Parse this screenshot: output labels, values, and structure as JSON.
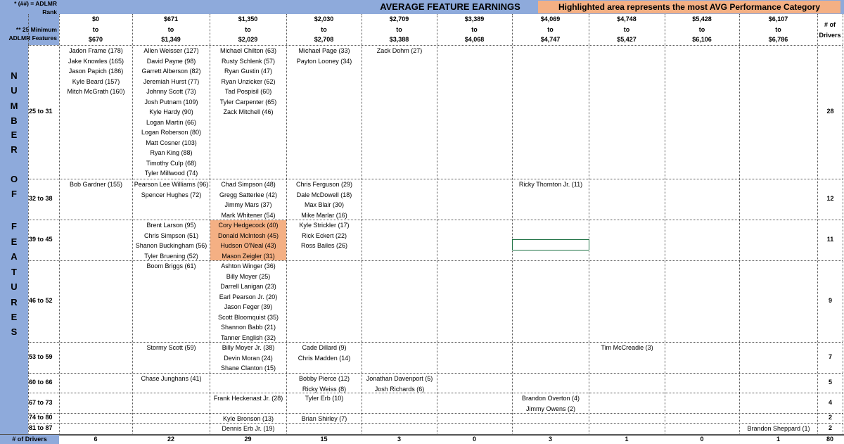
{
  "corner": {
    "line1": "* (##) = ADLMR",
    "line2": "Rank",
    "line3": "** 25  Minimum",
    "line4": "ADLMR Features"
  },
  "title": "AVERAGE FEATURE EARNINGS",
  "highlight_note": "Highlighted area represents the most AVG Performance Category",
  "ranges": [
    {
      "lo": "$0",
      "to": "to",
      "hi": "$670"
    },
    {
      "lo": "$671",
      "to": "to",
      "hi": "$1,349"
    },
    {
      "lo": "$1,350",
      "to": "to",
      "hi": "$2,029"
    },
    {
      "lo": "$2,030",
      "to": "to",
      "hi": "$2,708"
    },
    {
      "lo": "$2,709",
      "to": "to",
      "hi": "$3,388"
    },
    {
      "lo": "$3,389",
      "to": "to",
      "hi": "$4,068"
    },
    {
      "lo": "$4,069",
      "to": "to",
      "hi": "$4,747"
    },
    {
      "lo": "$4,748",
      "to": "to",
      "hi": "$5,427"
    },
    {
      "lo": "$5,428",
      "to": "to",
      "hi": "$6,106"
    },
    {
      "lo": "$6,107",
      "to": "to",
      "hi": "$6,786"
    }
  ],
  "count_header": {
    "line1": "# of",
    "line2": "Drivers"
  },
  "vertical_label": [
    "N",
    "U",
    "M",
    "B",
    "E",
    "R",
    "",
    "O",
    "F",
    "",
    "F",
    "E",
    "A",
    "T",
    "U",
    "R",
    "E",
    "S"
  ],
  "rows": [
    {
      "label": "25 to 31",
      "count": "28",
      "cells": [
        [
          "Jadon Frame (178)",
          "Jake Knowles (165)",
          "Jason Papich (186)",
          "Kyle Beard (157)",
          "Mitch McGrath (160)"
        ],
        [
          "Allen Weisser (127)",
          "David Payne (98)",
          "Garrett Alberson (82)",
          "Jeremiah Hurst (77)",
          "Johnny Scott (73)",
          "Josh Putnam (109)",
          "Kyle Hardy (90)",
          "Logan Martin (66)",
          "Logan Roberson (80)",
          "Matt Cosner (103)",
          "Ryan King (88)",
          "Timothy Culp (68)",
          "Tyler Millwood (74)"
        ],
        [
          "Michael Chilton (63)",
          "Rusty Schlenk (57)",
          "Ryan Gustin (47)",
          "Ryan Unzicker (62)",
          "Tad Pospisil (60)",
          "Tyler Carpenter (65)",
          "Zack Mitchell (46)"
        ],
        [
          "Michael Page (33)",
          "Payton Looney (34)"
        ],
        [
          "Zack Dohm (27)"
        ],
        [],
        [],
        [],
        [],
        []
      ]
    },
    {
      "label": "32 to 38",
      "count": "12",
      "cells": [
        [
          "Bob Gardner (155)"
        ],
        [
          "Pearson Lee Williams (96)",
          "Spencer Hughes (72)"
        ],
        [
          "Chad Simpson (48)",
          "Gregg Satterlee (42)",
          "Jimmy Mars (37)",
          "Mark Whitener (54)"
        ],
        [
          "Chris Ferguson (29)",
          "Dale McDowell (18)",
          "Max Blair (30)",
          "Mike Marlar (16)"
        ],
        [],
        [],
        [
          "Ricky Thornton Jr. (11)"
        ],
        [],
        [],
        []
      ]
    },
    {
      "label": "39 to 45",
      "count": "11",
      "cells": [
        [],
        [
          "Brent Larson (95)",
          "Chris Simpson (51)",
          "Shanon Buckingham (56)",
          "Tyler Bruening (52)"
        ],
        [
          "Cory Hedgecock (40)",
          "Donald McIntosh (45)",
          "Hudson O'Neal (43)",
          "Mason Zeigler (31)"
        ],
        [
          "Kyle Strickler (17)",
          "Rick Eckert (22)",
          "Ross Bailes (26)"
        ],
        [],
        [],
        [],
        [],
        [],
        []
      ]
    },
    {
      "label": "46 to 52",
      "count": "9",
      "cells": [
        [],
        [
          "Boom Briggs (61)"
        ],
        [
          "Ashton Winger (36)",
          "Billy Moyer (25)",
          "Darrell Lanigan (23)",
          "Earl Pearson Jr. (20)",
          "Jason Feger (39)",
          "Scott Bloomquist (35)",
          "Shannon Babb (21)",
          "Tanner English (32)"
        ],
        [],
        [],
        [],
        [],
        [],
        [],
        []
      ]
    },
    {
      "label": "53 to 59",
      "count": "7",
      "cells": [
        [],
        [
          "Stormy Scott (59)"
        ],
        [
          "Billy Moyer Jr. (38)",
          "Devin Moran (24)",
          "Shane Clanton (15)"
        ],
        [
          "Cade Dillard (9)",
          "Chris Madden (14)"
        ],
        [],
        [],
        [],
        [
          "Tim McCreadie (3)"
        ],
        [],
        []
      ]
    },
    {
      "label": "60 to 66",
      "count": "5",
      "cells": [
        [],
        [
          "Chase Junghans (41)"
        ],
        [],
        [
          "Bobby Pierce (12)",
          "Ricky Weiss (8)"
        ],
        [
          "Jonathan Davenport (5)",
          "Josh Richards (6)"
        ],
        [],
        [],
        [],
        [],
        []
      ]
    },
    {
      "label": "67 to 73",
      "count": "4",
      "cells": [
        [],
        [],
        [
          "Frank Heckenast Jr. (28)"
        ],
        [
          "Tyler Erb (10)"
        ],
        [],
        [],
        [
          "Brandon Overton (4)",
          "Jimmy Owens (2)"
        ],
        [],
        [],
        []
      ]
    },
    {
      "label": "74 to 80",
      "count": "2",
      "cells": [
        [],
        [],
        [
          "Kyle Bronson (13)"
        ],
        [
          "Brian Shirley (7)"
        ],
        [],
        [],
        [],
        [],
        [],
        []
      ]
    },
    {
      "label": "81 to 87",
      "count": "2",
      "cells": [
        [],
        [],
        [
          "Dennis Erb Jr. (19)"
        ],
        [],
        [],
        [],
        [],
        [],
        [],
        [
          "Brandon Sheppard (1)"
        ]
      ]
    }
  ],
  "footer": {
    "label": "# of Drivers",
    "counts": [
      "6",
      "22",
      "29",
      "15",
      "3",
      "0",
      "3",
      "1",
      "0",
      "1"
    ],
    "total": "80"
  }
}
